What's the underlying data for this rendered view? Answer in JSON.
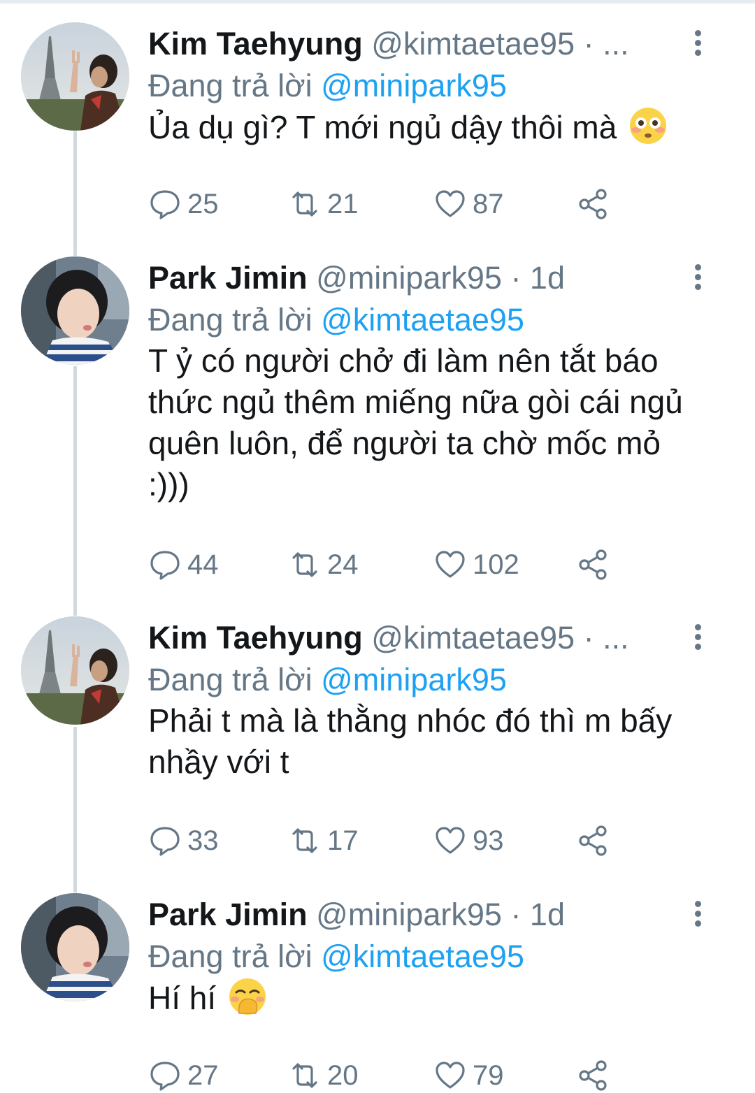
{
  "reply_prefix": "Đang trả lời",
  "tweets": [
    {
      "name": "Kim Taehyung",
      "handle": "@kimtaetae95",
      "time": "· ...",
      "reply_to": "@minipark95",
      "text": "Ủa dụ gì? T mới ngủ dậy thôi mà",
      "emoji": "flushed-face",
      "replies": "25",
      "retweets": "21",
      "likes": "87"
    },
    {
      "name": "Park Jimin",
      "handle": "@minipark95",
      "time": "· 1d",
      "reply_to": "@kimtaetae95",
      "text": "T ỷ có người chở đi làm nên tắt báo thức ngủ thêm miếng nữa gòi cái ngủ quên luôn, để người ta chờ mốc mỏ :)))",
      "emoji": "",
      "replies": "44",
      "retweets": "24",
      "likes": "102"
    },
    {
      "name": "Kim Taehyung",
      "handle": "@kimtaetae95",
      "time": "· ...",
      "reply_to": "@minipark95",
      "text": "Phải t mà là thằng nhóc đó thì m bấy nhầy với t",
      "emoji": "",
      "replies": "33",
      "retweets": "17",
      "likes": "93"
    },
    {
      "name": "Park Jimin",
      "handle": "@minipark95",
      "time": "· 1d",
      "reply_to": "@kimtaetae95",
      "text": "Hí hí",
      "emoji": "hand-over-mouth-face",
      "replies": "27",
      "retweets": "20",
      "likes": "79"
    }
  ],
  "colors": {
    "link": "#1da1f2",
    "muted": "#657786",
    "text": "#14171a",
    "thread": "#cfd9de"
  }
}
